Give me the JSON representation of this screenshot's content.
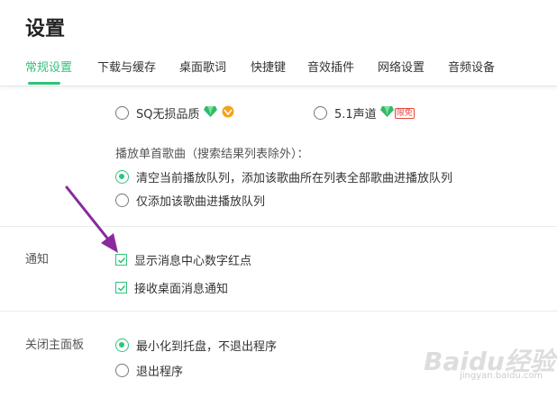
{
  "page": {
    "title": "设置"
  },
  "tabs": [
    {
      "label": "常规设置",
      "active": true
    },
    {
      "label": "下载与缓存"
    },
    {
      "label": "桌面歌词"
    },
    {
      "label": "快捷键"
    },
    {
      "label": "音效插件"
    },
    {
      "label": "网络设置"
    },
    {
      "label": "音频设备"
    }
  ],
  "quality": {
    "sq_label": "SQ无损品质",
    "surround_label": "5.1声道",
    "vip_tag": "限免"
  },
  "playback": {
    "heading": "播放单首歌曲（搜索结果列表除外）：",
    "option1": "清空当前播放队列，添加该歌曲所在列表全部歌曲进播放队列",
    "option2": "仅添加该歌曲进播放队列"
  },
  "notify": {
    "label": "通知",
    "option1": "显示消息中心数字红点",
    "option2": "接收桌面消息通知"
  },
  "close_panel": {
    "label": "关闭主面板",
    "option1": "最小化到托盘，不退出程序",
    "option2": "退出程序"
  },
  "watermark": {
    "text": "Baidu经验",
    "sub": "jingyan.baidu.com"
  },
  "colors": {
    "accent": "#31c27c",
    "annotation_arrow": "#8a2a9b"
  },
  "icons": {
    "diamond": "green-diamond-icon",
    "vip": "vip-crown-icon"
  }
}
